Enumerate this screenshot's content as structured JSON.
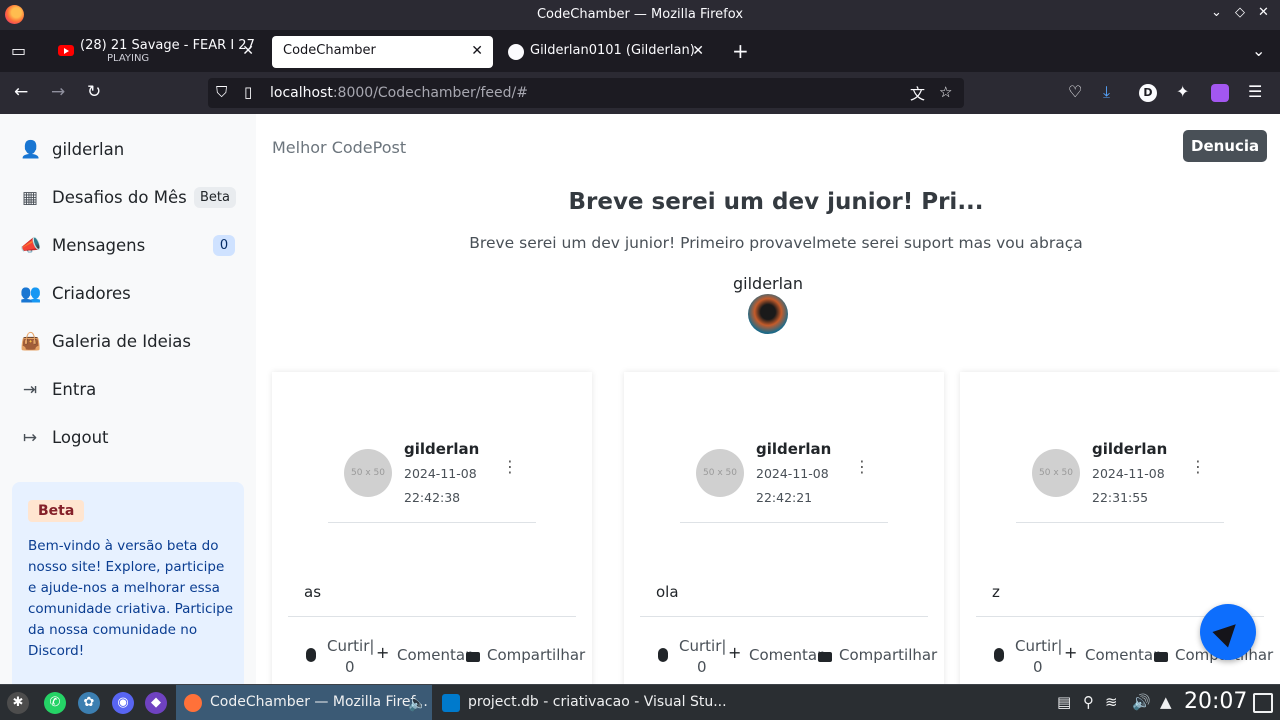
{
  "window": {
    "title": "CodeChamber — Mozilla Firefox"
  },
  "tabs": [
    {
      "label": "(28) 21 Savage - FEAR I 27",
      "sub": "PLAYING",
      "close": "✕"
    },
    {
      "label": "CodeChamber",
      "close": "✕"
    },
    {
      "label": "Gilderlan0101 (Gilderlan)",
      "close": "✕"
    }
  ],
  "new_tab": "+",
  "address": {
    "host": "localhost",
    "rest": ":8000/Codechamber/feed/#"
  },
  "sidebar": {
    "items": [
      {
        "icon": "user-icon",
        "glyph": "👤",
        "label": "gilderlan"
      },
      {
        "icon": "grid-icon",
        "glyph": "▦",
        "label": "Desafios do Mês",
        "badge": "Beta"
      },
      {
        "icon": "megaphone-icon",
        "glyph": "📣",
        "label": "Mensagens",
        "badge": "0"
      },
      {
        "icon": "users-icon",
        "glyph": "👥",
        "label": "Criadores"
      },
      {
        "icon": "bag-icon",
        "glyph": "👜",
        "label": "Galeria de Ideias"
      },
      {
        "icon": "login-icon",
        "glyph": "⇥",
        "label": "Entra"
      },
      {
        "icon": "logout-icon",
        "glyph": "↦",
        "label": "Logout"
      }
    ],
    "beta_box": {
      "badge": "Beta",
      "text": "Bem-vindo à versão beta do nosso site! Explore, participe e ajude-nos a melhorar essa comunidade criativa. Participe da nossa comunidade no Discord!"
    }
  },
  "best_post": {
    "label": "Melhor CodePost",
    "report": "Denucia",
    "title": "Breve serei um dev junior! Pri...",
    "description": "Breve serei um dev junior! Primeiro provavelmete serei suport mas vou abraça",
    "author": "gilderlan"
  },
  "posts": [
    {
      "avatar": "50 x 50",
      "user": "gilderlan",
      "date": "2024-11-08",
      "time": "22:42:38",
      "content": "as",
      "like": "Curtir|",
      "likes": "0",
      "comment": "Comentar",
      "share": "Compartilhar"
    },
    {
      "avatar": "50 x 50",
      "user": "gilderlan",
      "date": "2024-11-08",
      "time": "22:42:21",
      "content": "ola",
      "like": "Curtir|",
      "likes": "0",
      "comment": "Comentar",
      "share": "Compartilhar"
    },
    {
      "avatar": "50 x 50",
      "user": "gilderlan",
      "date": "2024-11-08",
      "time": "22:31:55",
      "content": "z",
      "like": "Curtir|",
      "likes": "0",
      "comment": "Comentar",
      "share": "Compartilhar"
    }
  ],
  "taskbar": {
    "windows": [
      {
        "label": "CodeChamber — Mozilla Firef..."
      },
      {
        "label": "project.db - criativacao - Visual Stu..."
      }
    ],
    "clock": "20:07"
  },
  "colors": {
    "accent": "#0d6efd",
    "chrome_dark": "#2b2a33",
    "report_button": "#495057"
  }
}
